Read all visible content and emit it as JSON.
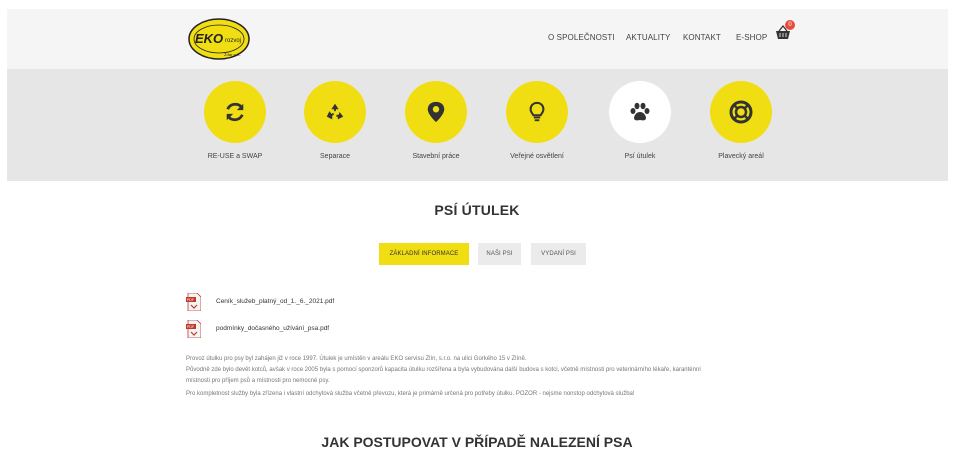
{
  "header": {
    "logo_text": "EKO",
    "logo_subtext": "rozvoj",
    "logo_bottom": "Žďár n.S.",
    "nav": [
      {
        "label": "O SPOLEČNOSTI"
      },
      {
        "label": "AKTUALITY"
      },
      {
        "label": "KONTAKT"
      },
      {
        "label": "E-SHOP"
      }
    ],
    "cart_count": "0"
  },
  "services": [
    {
      "label": "RE-USE a SWAP",
      "icon": "refresh-icon"
    },
    {
      "label": "Separace",
      "icon": "recycle-icon"
    },
    {
      "label": "Stavební práce",
      "icon": "map-pin-icon"
    },
    {
      "label": "Veřejné osvětlení",
      "icon": "lightbulb-icon"
    },
    {
      "label": "Psí útulek",
      "icon": "paw-icon"
    },
    {
      "label": "Plavecký areál",
      "icon": "lifebuoy-icon"
    }
  ],
  "page_title": "PSÍ ÚTULEK",
  "tabs": [
    {
      "label": "ZÁKLADNÍ INFORMACE"
    },
    {
      "label": "NAŠI PSI"
    },
    {
      "label": "VYDANÍ PSI"
    }
  ],
  "files": [
    {
      "name": "Ceník_služeb_platný_od_1._6._2021.pdf"
    },
    {
      "name": "podmínky_dočasného_užívání_psa.pdf"
    }
  ],
  "paragraphs": [
    "Provoz útulku pro psy byl zahájen již v roce 1997. Útulek je umístěn v areálu EKO servisu Zlín, s.r.o. na ulici Gorkého 15 v Zlíně.",
    "Původně zde bylo devět kotců, avšak v roce 2005 byla s pomocí sponzorů kapacita útulku rozšířena a byla vybudována další budova s kotci, včetně místnosti pro veterinárního lékaře, karanténní",
    "místnosti pro příjem psů a místnosti pro nemocné psy.",
    "Pro kompletnost služby byla zřízena i vlastní odchytová služba včetně převozu, která je primárně určená pro potřeby útulku. POZOR - nejsme nonstop odchytová služba!"
  ],
  "section_title": "JAK POSTUPOVAT V PŘÍPADĚ NALEZENÍ PSA",
  "colors": {
    "accent": "#f0de13",
    "badge": "#e74c3c"
  }
}
